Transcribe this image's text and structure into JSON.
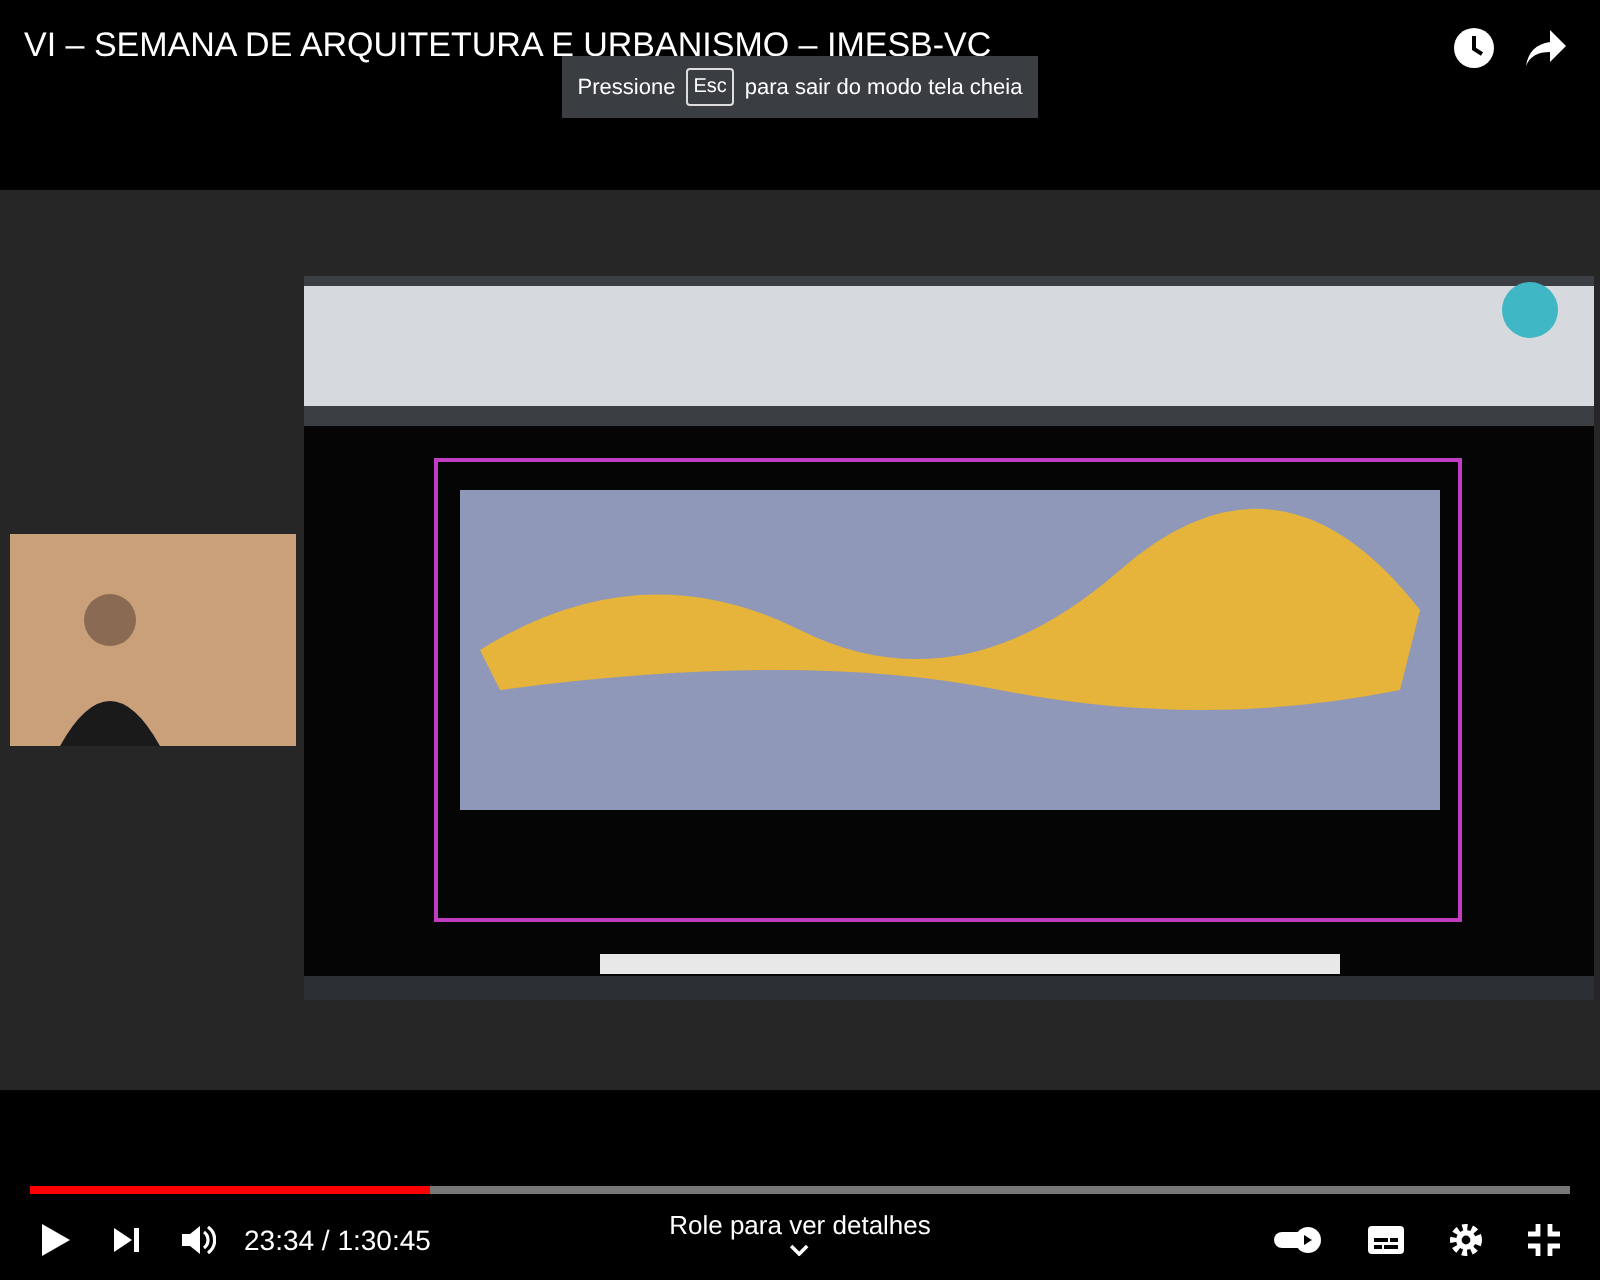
{
  "video": {
    "title": "VI – SEMANA DE ARQUITETURA E URBANISMO – IMESB-VC"
  },
  "toast": {
    "before": "Pressione",
    "key": "Esc",
    "after": "para sair do modo tela cheia"
  },
  "progress": {
    "level": 0.26
  },
  "time": "23:34 / 1:30:45",
  "hint": "Role para ver detalhes",
  "autoplay": {
    "on": true
  }
}
